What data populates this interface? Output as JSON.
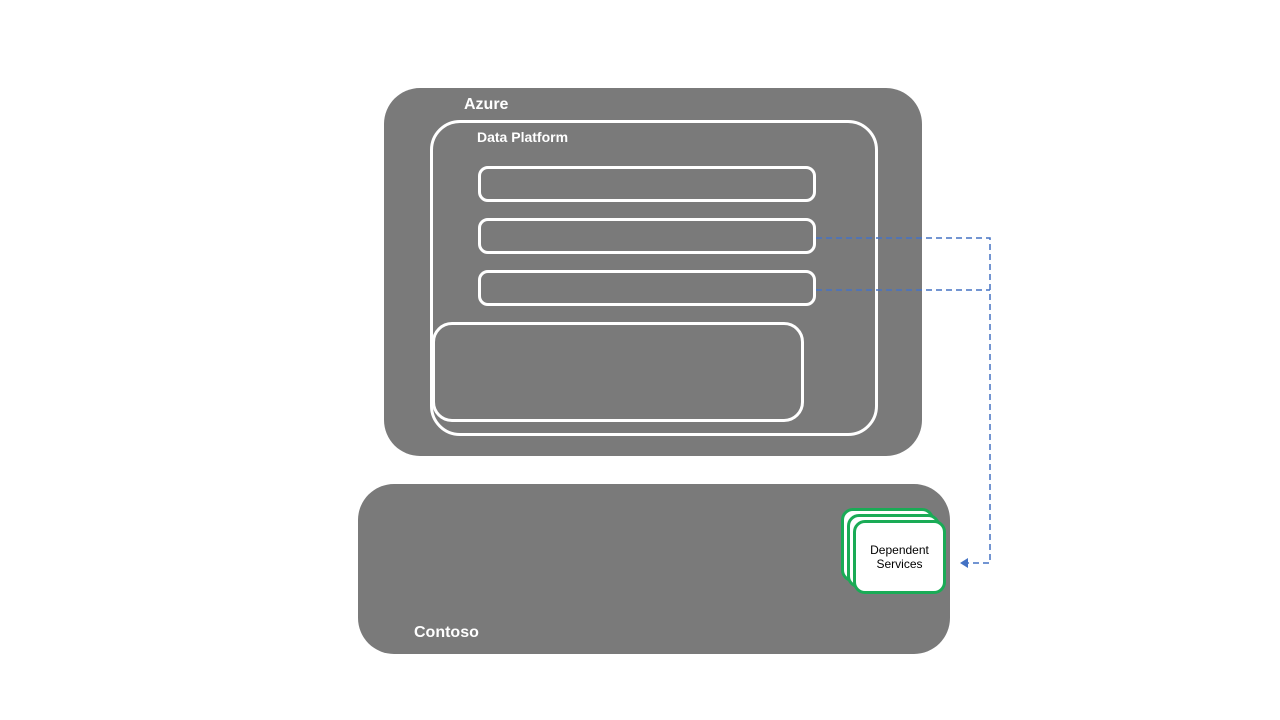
{
  "diagram": {
    "azure": {
      "label": "Azure",
      "data_platform": {
        "label": "Data Platform",
        "slots": [
          {
            "id": "slot-1"
          },
          {
            "id": "slot-2"
          },
          {
            "id": "slot-3"
          },
          {
            "id": "slot-4"
          }
        ]
      }
    },
    "contoso": {
      "label": "Contoso",
      "dependent_services": {
        "line1": "Dependent",
        "line2": "Services"
      }
    },
    "colors": {
      "container_bg": "#7a7a7a",
      "border_white": "#ffffff",
      "card_border": "#1aab56",
      "connector": "#4472c4"
    },
    "connectors": [
      {
        "from": "slot-2",
        "to": "dependent-services"
      },
      {
        "from": "slot-3",
        "to": "dependent-services"
      }
    ]
  }
}
